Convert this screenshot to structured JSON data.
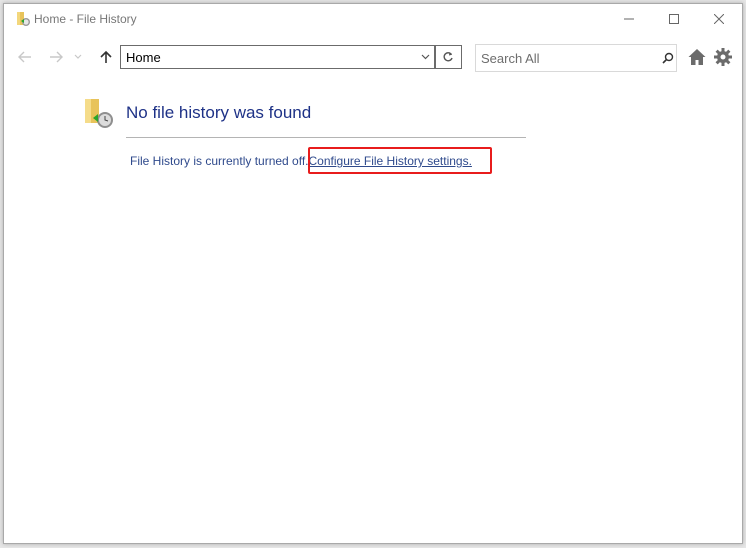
{
  "window": {
    "title": "Home - File History",
    "controls": {
      "minimize": "minimize",
      "maximize": "maximize",
      "close": "close"
    }
  },
  "toolbar": {
    "address_value": "Home",
    "search_placeholder": "Search All",
    "icons": [
      "back-arrow-icon",
      "forward-arrow-icon",
      "recent-locations-chevron-icon",
      "up-arrow-icon",
      "refresh-icon",
      "search-icon",
      "home-icon",
      "gear-icon"
    ]
  },
  "main": {
    "heading": "No file history was found",
    "status_text": "File History is currently turned off.",
    "link_text": "Configure File History settings."
  },
  "colors": {
    "heading": "#1e3287",
    "link": "#2f4a8c",
    "highlight_box": "#e81c1c"
  }
}
